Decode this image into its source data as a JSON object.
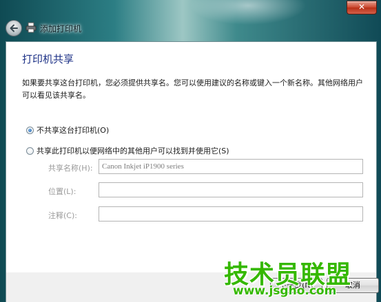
{
  "window": {
    "close_label": "✕",
    "title": "添加打印机"
  },
  "page": {
    "heading": "打印机共享",
    "description": "如果要共享这台打印机，您必须提供共享名。您可以使用建议的名称或键入一个新名称。其他网络用户可以看见该共享名。"
  },
  "options": {
    "no_share_label": "不共享这台打印机(O)",
    "no_share_selected": true,
    "share_label": "共享此打印机以便网络中的其他用户可以找到并使用它(S)",
    "share_selected": false
  },
  "fields": {
    "share_name_label": "共享名称(H):",
    "share_name_value": "Canon Inkjet iP1900 series",
    "location_label": "位置(L):",
    "location_value": "",
    "comment_label": "注释(C):",
    "comment_value": ""
  },
  "buttons": {
    "next_label": "下一步(N)",
    "cancel_label": "取消"
  },
  "watermark": {
    "text": "技术员联盟",
    "url": "www.jsgho.com"
  },
  "colors": {
    "heading": "#1e3287",
    "watermark": "#35b800"
  },
  "icons": {
    "back": "back-arrow-icon",
    "title": "printer-icon"
  }
}
